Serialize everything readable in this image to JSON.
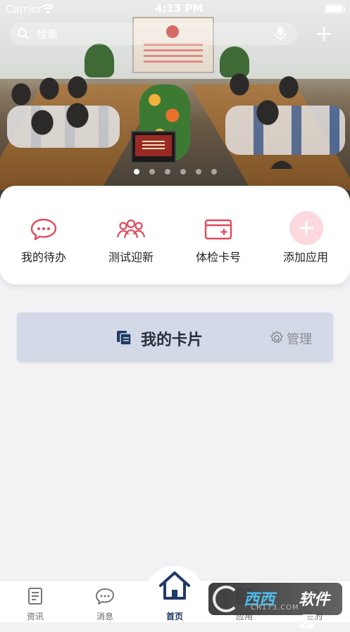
{
  "status_bar": {
    "carrier": "Carrier",
    "time": "4:13 PM"
  },
  "search": {
    "placeholder": "搜索"
  },
  "banner": {
    "page_count": 6,
    "active_page": 1
  },
  "quick_apps": [
    {
      "label": "我的待办",
      "icon": "chat-bubble-icon"
    },
    {
      "label": "测试迎新",
      "icon": "group-people-icon"
    },
    {
      "label": "体检卡号",
      "icon": "card-plus-icon"
    },
    {
      "label": "添加应用",
      "icon": "add-icon"
    }
  ],
  "my_cards": {
    "title": "我的卡片",
    "manage_label": "管理"
  },
  "tabbar": {
    "tabs": [
      {
        "label": "资讯",
        "icon": "news-icon"
      },
      {
        "label": "消息",
        "icon": "message-icon"
      },
      {
        "label": "首页",
        "icon": "home-icon",
        "active": true
      },
      {
        "label": "应用",
        "icon": "apps-icon"
      },
      {
        "label": "我的",
        "icon": "profile-icon"
      }
    ]
  },
  "watermark": {
    "text1": "西西",
    "text2": "软件园",
    "subtext": "CR173.COM"
  },
  "colors": {
    "accent_red": "#e04a5c",
    "primary_navy": "#1f3a66",
    "card_bg": "#d3d9e6"
  }
}
